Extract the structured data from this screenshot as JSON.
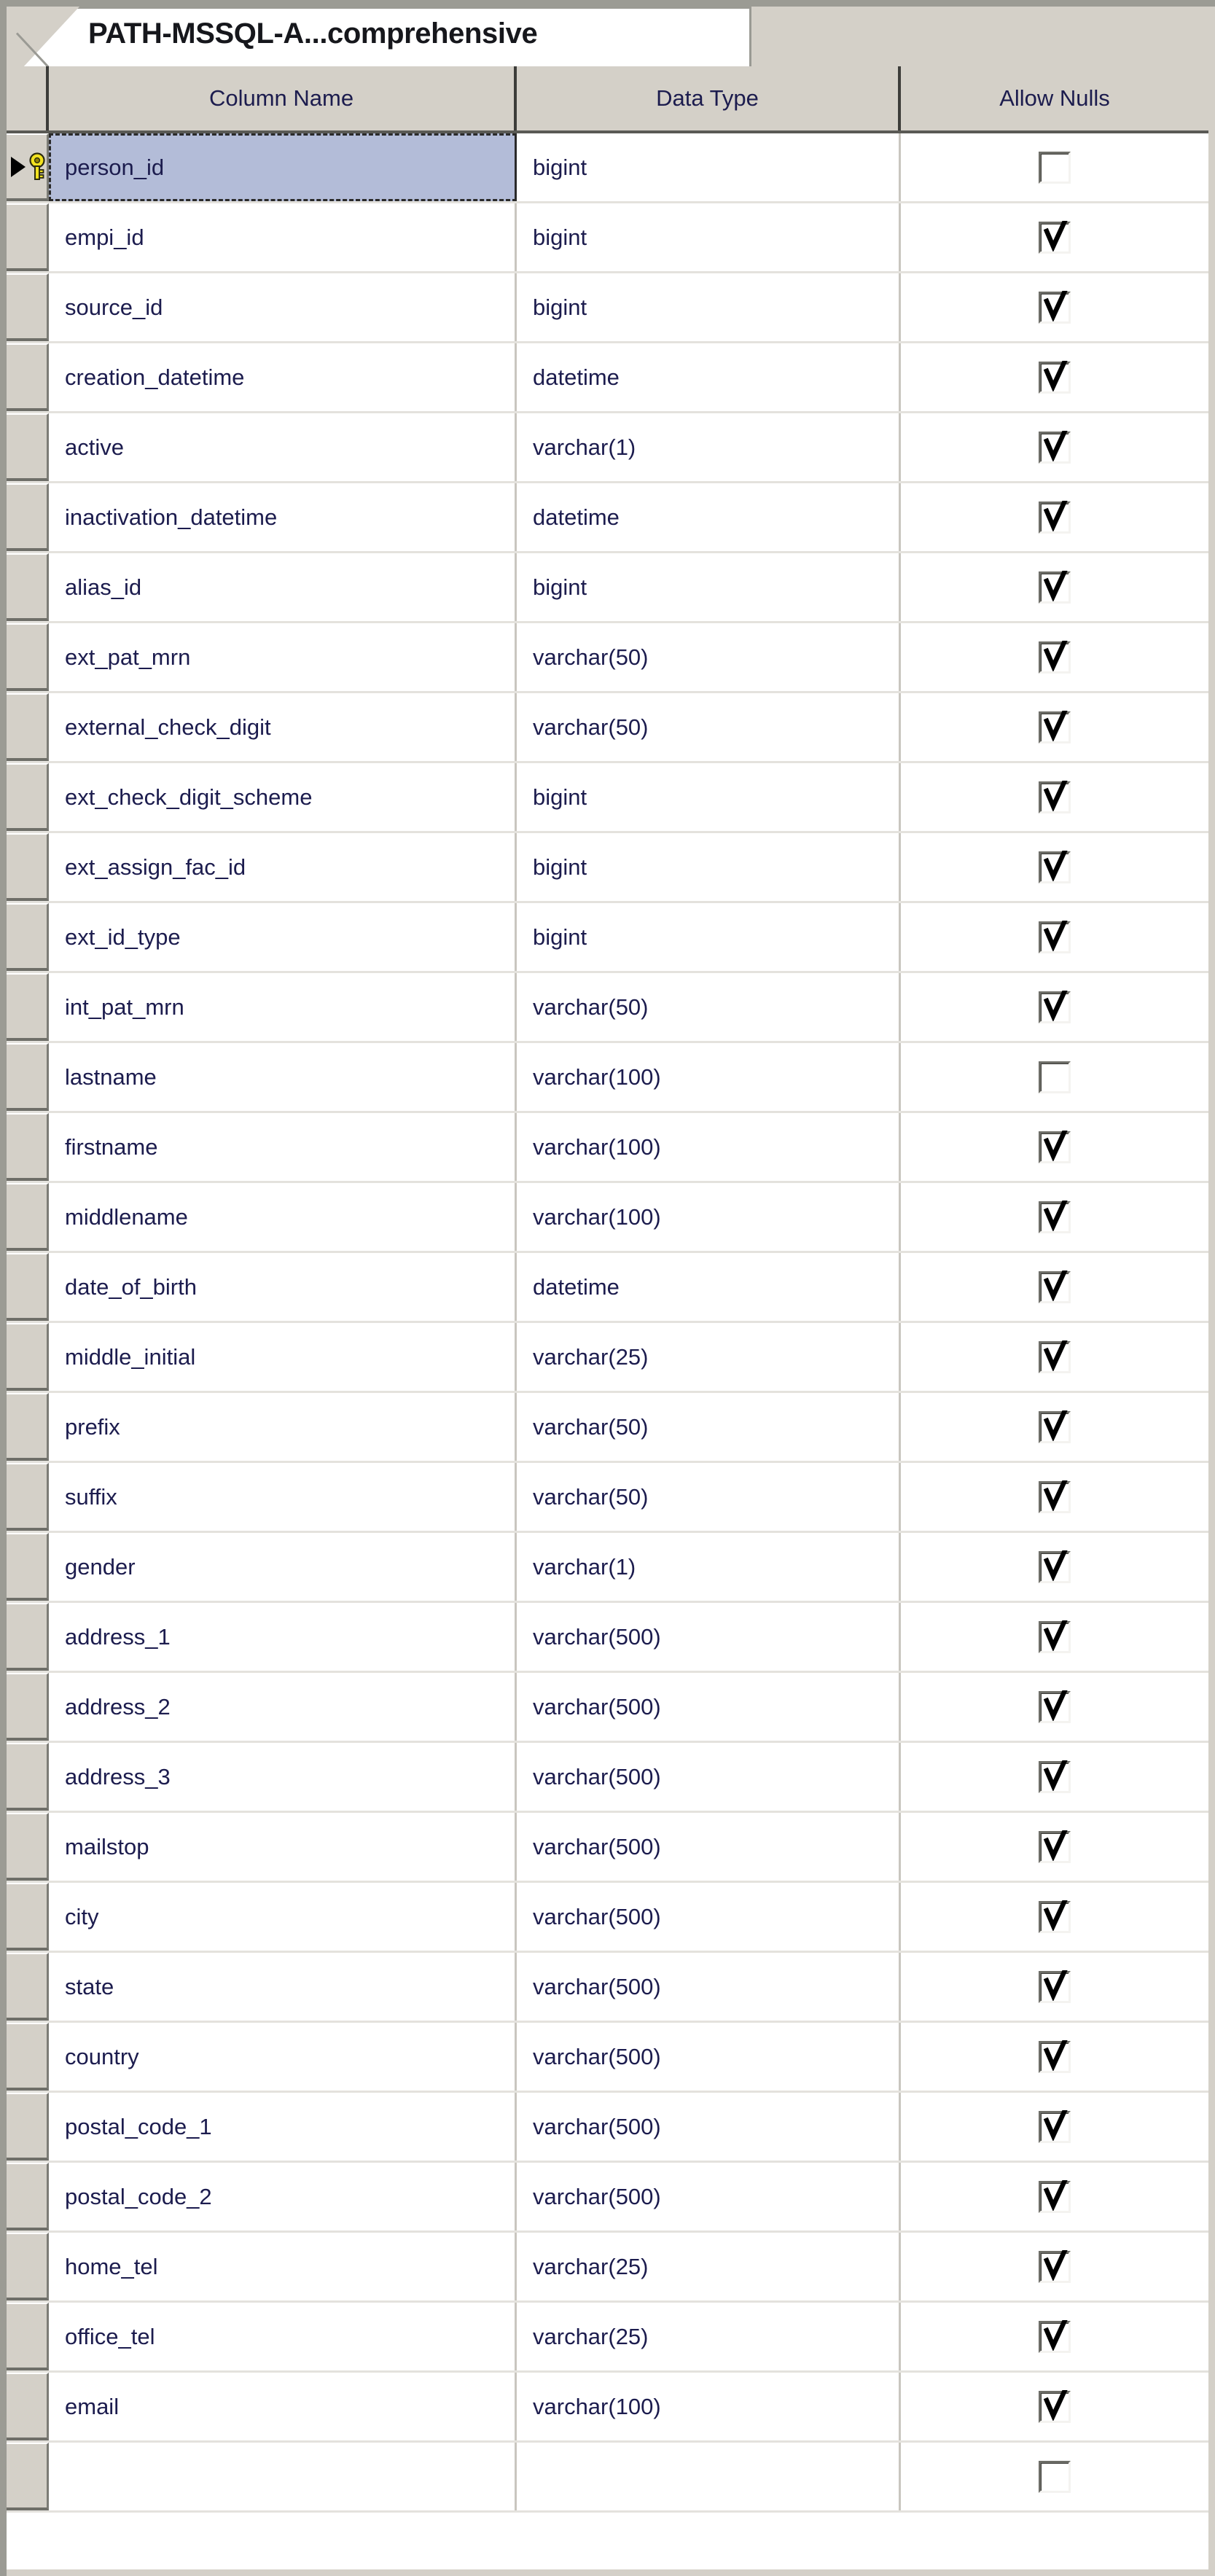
{
  "window": {
    "type": "table-designer",
    "accent_selection_color": "#b3bcd8",
    "chrome_color": "#d4d0c8",
    "text_color": "#1c1c4e"
  },
  "tab": {
    "label": "PATH-MSSQL-A...comprehensive",
    "active": true
  },
  "grid": {
    "headers": {
      "row_selector": "",
      "column_name": "Column Name",
      "data_type": "Data Type",
      "allow_nulls": "Allow Nulls"
    },
    "rows": [
      {
        "column_name": "person_id",
        "data_type": "bigint",
        "allow_nulls": false,
        "primary_key": true,
        "selected": true
      },
      {
        "column_name": "empi_id",
        "data_type": "bigint",
        "allow_nulls": true,
        "primary_key": false,
        "selected": false
      },
      {
        "column_name": "source_id",
        "data_type": "bigint",
        "allow_nulls": true,
        "primary_key": false,
        "selected": false
      },
      {
        "column_name": "creation_datetime",
        "data_type": "datetime",
        "allow_nulls": true,
        "primary_key": false,
        "selected": false
      },
      {
        "column_name": "active",
        "data_type": "varchar(1)",
        "allow_nulls": true,
        "primary_key": false,
        "selected": false
      },
      {
        "column_name": "inactivation_datetime",
        "data_type": "datetime",
        "allow_nulls": true,
        "primary_key": false,
        "selected": false
      },
      {
        "column_name": "alias_id",
        "data_type": "bigint",
        "allow_nulls": true,
        "primary_key": false,
        "selected": false
      },
      {
        "column_name": "ext_pat_mrn",
        "data_type": "varchar(50)",
        "allow_nulls": true,
        "primary_key": false,
        "selected": false
      },
      {
        "column_name": "external_check_digit",
        "data_type": "varchar(50)",
        "allow_nulls": true,
        "primary_key": false,
        "selected": false
      },
      {
        "column_name": "ext_check_digit_scheme",
        "data_type": "bigint",
        "allow_nulls": true,
        "primary_key": false,
        "selected": false
      },
      {
        "column_name": "ext_assign_fac_id",
        "data_type": "bigint",
        "allow_nulls": true,
        "primary_key": false,
        "selected": false
      },
      {
        "column_name": "ext_id_type",
        "data_type": "bigint",
        "allow_nulls": true,
        "primary_key": false,
        "selected": false
      },
      {
        "column_name": "int_pat_mrn",
        "data_type": "varchar(50)",
        "allow_nulls": true,
        "primary_key": false,
        "selected": false
      },
      {
        "column_name": "lastname",
        "data_type": "varchar(100)",
        "allow_nulls": false,
        "primary_key": false,
        "selected": false
      },
      {
        "column_name": "firstname",
        "data_type": "varchar(100)",
        "allow_nulls": true,
        "primary_key": false,
        "selected": false
      },
      {
        "column_name": "middlename",
        "data_type": "varchar(100)",
        "allow_nulls": true,
        "primary_key": false,
        "selected": false
      },
      {
        "column_name": "date_of_birth",
        "data_type": "datetime",
        "allow_nulls": true,
        "primary_key": false,
        "selected": false
      },
      {
        "column_name": "middle_initial",
        "data_type": "varchar(25)",
        "allow_nulls": true,
        "primary_key": false,
        "selected": false
      },
      {
        "column_name": "prefix",
        "data_type": "varchar(50)",
        "allow_nulls": true,
        "primary_key": false,
        "selected": false
      },
      {
        "column_name": "suffix",
        "data_type": "varchar(50)",
        "allow_nulls": true,
        "primary_key": false,
        "selected": false
      },
      {
        "column_name": "gender",
        "data_type": "varchar(1)",
        "allow_nulls": true,
        "primary_key": false,
        "selected": false
      },
      {
        "column_name": "address_1",
        "data_type": "varchar(500)",
        "allow_nulls": true,
        "primary_key": false,
        "selected": false
      },
      {
        "column_name": "address_2",
        "data_type": "varchar(500)",
        "allow_nulls": true,
        "primary_key": false,
        "selected": false
      },
      {
        "column_name": "address_3",
        "data_type": "varchar(500)",
        "allow_nulls": true,
        "primary_key": false,
        "selected": false
      },
      {
        "column_name": "mailstop",
        "data_type": "varchar(500)",
        "allow_nulls": true,
        "primary_key": false,
        "selected": false
      },
      {
        "column_name": "city",
        "data_type": "varchar(500)",
        "allow_nulls": true,
        "primary_key": false,
        "selected": false
      },
      {
        "column_name": "state",
        "data_type": "varchar(500)",
        "allow_nulls": true,
        "primary_key": false,
        "selected": false
      },
      {
        "column_name": "country",
        "data_type": "varchar(500)",
        "allow_nulls": true,
        "primary_key": false,
        "selected": false
      },
      {
        "column_name": "postal_code_1",
        "data_type": "varchar(500)",
        "allow_nulls": true,
        "primary_key": false,
        "selected": false
      },
      {
        "column_name": "postal_code_2",
        "data_type": "varchar(500)",
        "allow_nulls": true,
        "primary_key": false,
        "selected": false
      },
      {
        "column_name": "home_tel",
        "data_type": "varchar(25)",
        "allow_nulls": true,
        "primary_key": false,
        "selected": false
      },
      {
        "column_name": "office_tel",
        "data_type": "varchar(25)",
        "allow_nulls": true,
        "primary_key": false,
        "selected": false
      },
      {
        "column_name": "email",
        "data_type": "varchar(100)",
        "allow_nulls": true,
        "primary_key": false,
        "selected": false
      },
      {
        "column_name": "",
        "data_type": "",
        "allow_nulls": false,
        "primary_key": false,
        "selected": false
      }
    ]
  },
  "icons": {
    "primary_key": "key-icon",
    "current_row": "row-arrow-icon",
    "checked": "checkmark-icon"
  }
}
